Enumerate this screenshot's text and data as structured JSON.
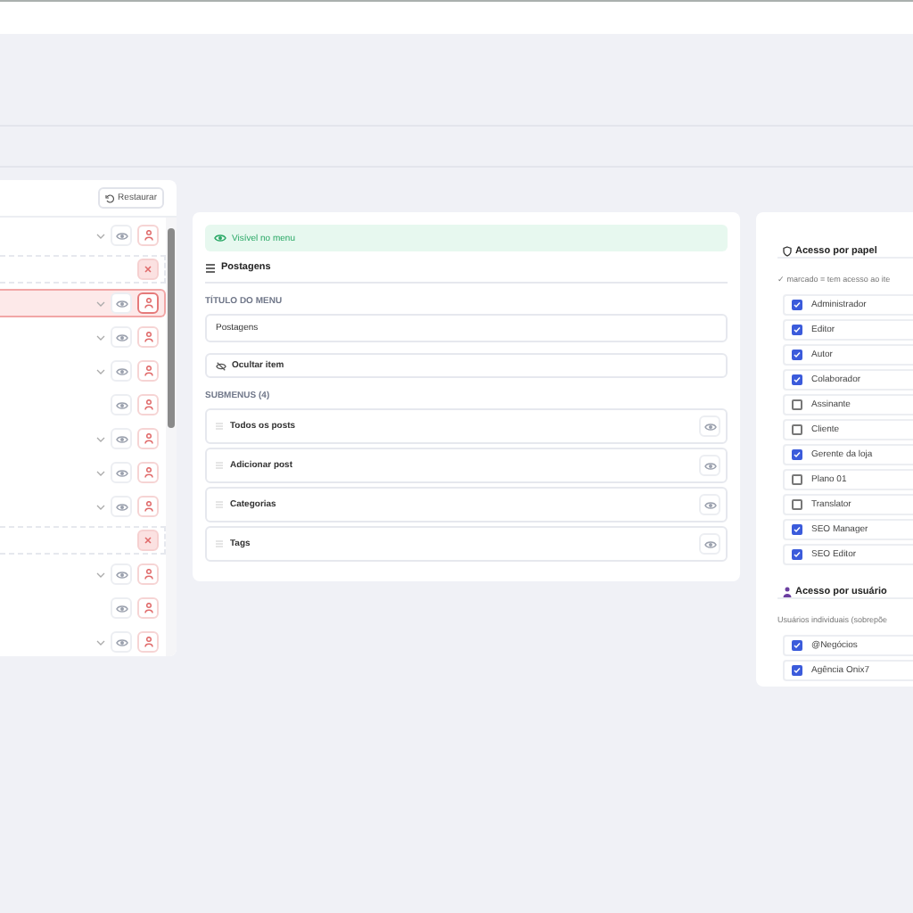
{
  "tree": {
    "restore_button": "Restaurar",
    "rows": [
      {
        "kind": "item",
        "expandable": true,
        "selected": false
      },
      {
        "kind": "hidden",
        "selected": false
      },
      {
        "kind": "item",
        "expandable": true,
        "selected": true
      },
      {
        "kind": "item",
        "expandable": true,
        "selected": false
      },
      {
        "kind": "item",
        "expandable": true,
        "selected": false
      },
      {
        "kind": "item",
        "expandable": false,
        "selected": false
      },
      {
        "kind": "item",
        "expandable": true,
        "selected": false
      },
      {
        "kind": "item",
        "expandable": true,
        "selected": false
      },
      {
        "kind": "item",
        "expandable": true,
        "selected": false
      },
      {
        "kind": "hidden",
        "selected": false
      },
      {
        "kind": "item",
        "expandable": true,
        "selected": false
      },
      {
        "kind": "item",
        "expandable": false,
        "selected": false
      },
      {
        "kind": "item",
        "expandable": true,
        "selected": false
      }
    ]
  },
  "editor": {
    "visibility_banner": "Visível no menu",
    "heading": "Postagens",
    "title_label": "TÍTULO DO MENU",
    "title_field": {
      "value": "Postagens"
    },
    "hide_button": "Ocultar item",
    "submenus_label": "SUBMENUS (4)",
    "submenus": [
      {
        "label": "Todos os posts"
      },
      {
        "label": "Adicionar post"
      },
      {
        "label": "Categorias"
      },
      {
        "label": "Tags"
      }
    ]
  },
  "access": {
    "roles": {
      "heading": "Acesso por papel",
      "hint": "✓ marcado = tem acesso ao ite",
      "items": [
        {
          "label": "Administrador",
          "checked": true
        },
        {
          "label": "Editor",
          "checked": true
        },
        {
          "label": "Autor",
          "checked": true
        },
        {
          "label": "Colaborador",
          "checked": true
        },
        {
          "label": "Assinante",
          "checked": false
        },
        {
          "label": "Cliente",
          "checked": false
        },
        {
          "label": "Gerente da loja",
          "checked": true
        },
        {
          "label": "Plano 01",
          "checked": false
        },
        {
          "label": "Translator",
          "checked": false
        },
        {
          "label": "SEO Manager",
          "checked": true
        },
        {
          "label": "SEO Editor",
          "checked": true
        }
      ]
    },
    "users": {
      "heading": "Acesso por usuário",
      "hint": "Usuários individuais (sobrepõe",
      "items": [
        {
          "label": "@Negócios",
          "checked": true
        },
        {
          "label": "Agência Onix7",
          "checked": true
        }
      ]
    }
  }
}
